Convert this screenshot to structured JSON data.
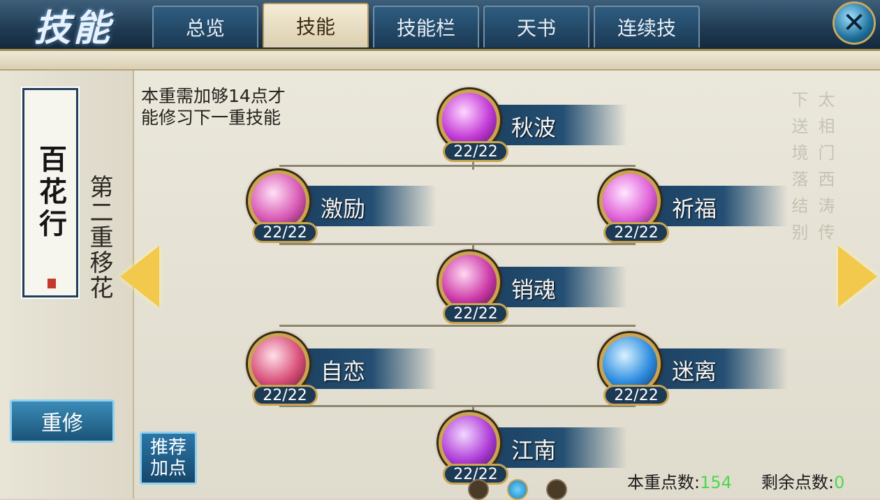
{
  "header": {
    "title": "技能",
    "tabs": [
      {
        "label": "总览",
        "active": false
      },
      {
        "label": "技能",
        "active": true
      },
      {
        "label": "技能栏",
        "active": false
      },
      {
        "label": "天书",
        "active": false
      },
      {
        "label": "连续技",
        "active": false
      }
    ],
    "close_icon": "close-icon"
  },
  "sidebar": {
    "school": "百花行",
    "realm": "第二重移花",
    "reset_button": "重修"
  },
  "main": {
    "requirement": "本重需加够14点才\n能修习下一重技能",
    "recommend_button": "推荐\n加点",
    "background_text": "太相门西涛传下送境落结别"
  },
  "skills": [
    {
      "name": "秋波",
      "level": "22/22",
      "color": "#c23ad6"
    },
    {
      "name": "激励",
      "level": "22/22",
      "color": "#d85ab5"
    },
    {
      "name": "祈福",
      "level": "22/22",
      "color": "#e060d8"
    },
    {
      "name": "销魂",
      "level": "22/22",
      "color": "#cc3aa8"
    },
    {
      "name": "自恋",
      "level": "22/22",
      "color": "#d8507a"
    },
    {
      "name": "迷离",
      "level": "22/22",
      "color": "#2f8de0"
    },
    {
      "name": "江南",
      "level": "22/22",
      "color": "#b03ed8"
    }
  ],
  "footer": {
    "tier_points_label": "本重点数:",
    "tier_points_value": "154",
    "remaining_points_label": "剩余点数:",
    "remaining_points_value": "0",
    "page_count": 3,
    "current_page": 2
  }
}
